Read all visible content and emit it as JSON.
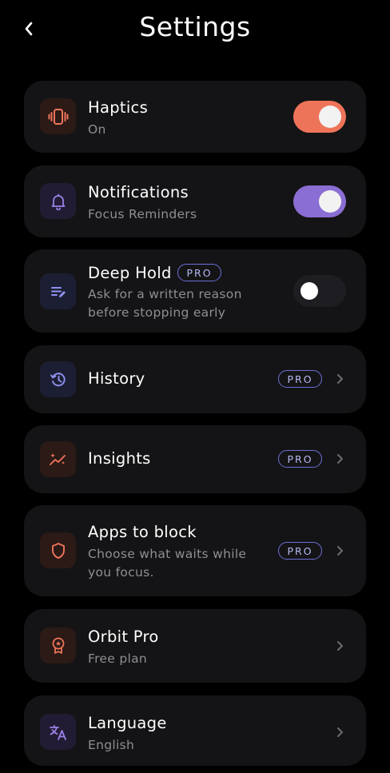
{
  "header": {
    "title": "Settings"
  },
  "settings": {
    "haptics": {
      "title": "Haptics",
      "subtitle": "On",
      "icon": "vibrate-icon",
      "toggle_state": "on"
    },
    "notifications": {
      "title": "Notifications",
      "subtitle": "Focus Reminders",
      "icon": "bell-icon",
      "toggle_state": "on"
    },
    "deep_hold": {
      "title": "Deep Hold",
      "badge": "PRO",
      "subtitle_line1": "Ask for a written reason",
      "subtitle_line2": "before stopping early",
      "icon": "note-edit-icon",
      "toggle_state": "off"
    },
    "history": {
      "title": "History",
      "badge": "PRO",
      "icon": "history-clock-icon"
    },
    "insights": {
      "title": "Insights",
      "badge": "PRO",
      "icon": "sparkle-chart-icon"
    },
    "apps_to_block": {
      "title": "Apps to block",
      "subtitle_line1": "Choose what waits while",
      "subtitle_line2": "you focus.",
      "badge": "PRO",
      "icon": "shield-icon"
    },
    "orbit_pro": {
      "title": "Orbit Pro",
      "subtitle": "Free plan",
      "icon": "award-badge-icon"
    },
    "language": {
      "title": "Language",
      "subtitle": "English",
      "icon": "translate-icon"
    }
  },
  "colors": {
    "background": "#000000",
    "card": "#141416",
    "orange_accent": "#ee7459",
    "purple_accent": "#8a6ed3",
    "pro_badge_border": "#6d6fd8",
    "subtitle_text": "#8e8e96"
  }
}
